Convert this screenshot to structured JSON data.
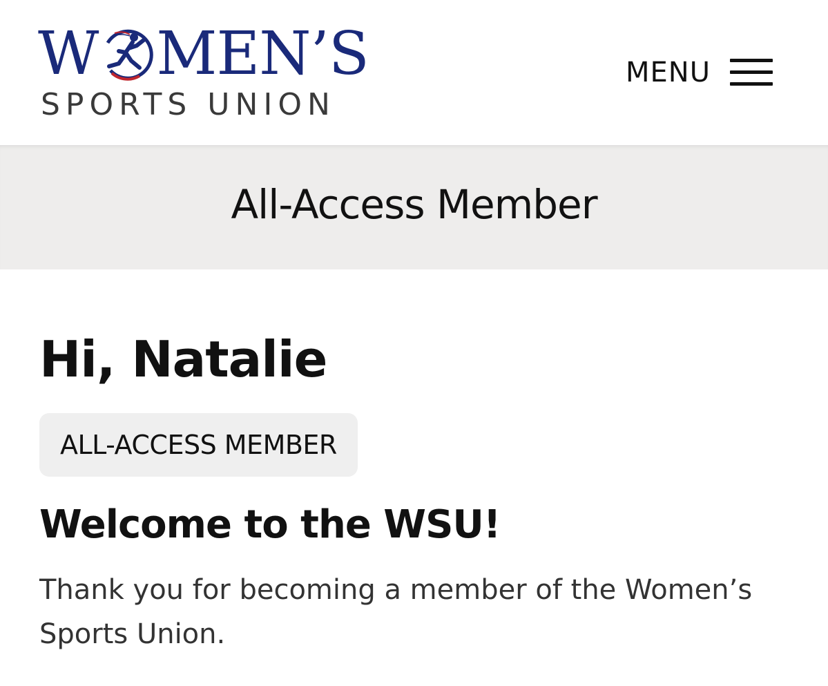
{
  "header": {
    "logo": {
      "top_text_w": "W",
      "top_text_rest": "MEN’S",
      "bottom_text": "SPORTS UNION",
      "colors": {
        "navy": "#1a2a7a",
        "red": "#c0262e",
        "gray": "#3a3a3a"
      }
    },
    "menu_label": "MENU",
    "menu_icon": "hamburger-icon"
  },
  "banner": {
    "title": "All-Access Member"
  },
  "main": {
    "greeting": "Hi, Natalie",
    "membership_badge": "ALL-ACCESS MEMBER",
    "welcome_heading": "Welcome to the WSU!",
    "thanks_text": "Thank you for becoming a member of the Women’s Sports Union."
  }
}
